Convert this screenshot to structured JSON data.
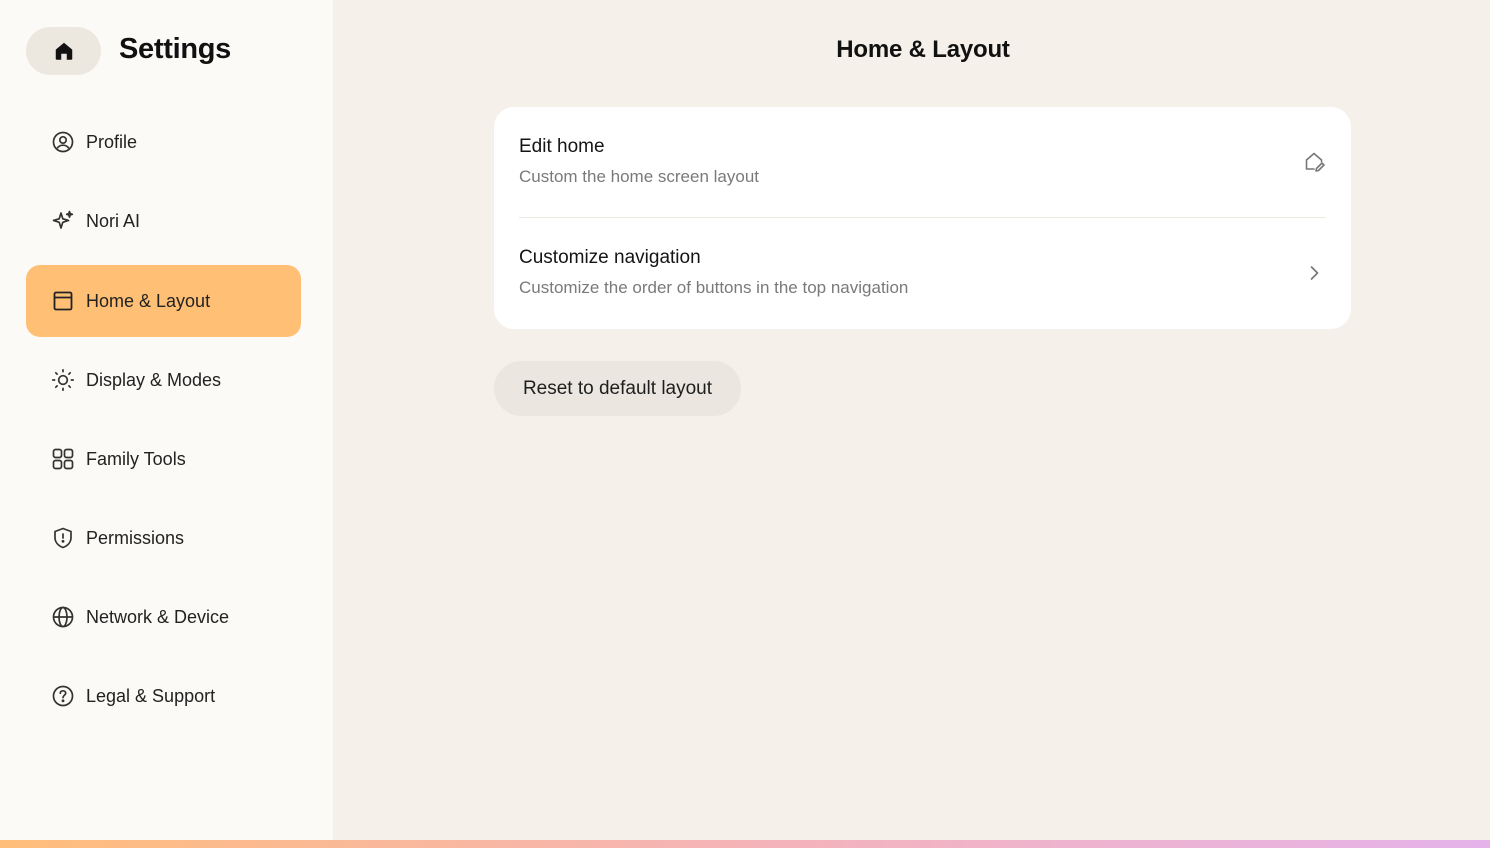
{
  "sidebar": {
    "title": "Settings",
    "home_icon": "home-icon",
    "items": [
      {
        "label": "Profile",
        "icon": "user-circle-icon"
      },
      {
        "label": "Nori AI",
        "icon": "sparkle-icon"
      },
      {
        "label": "Home & Layout",
        "icon": "layout-icon",
        "active": true
      },
      {
        "label": "Display & Modes",
        "icon": "sun-icon"
      },
      {
        "label": "Family Tools",
        "icon": "grid-icon"
      },
      {
        "label": "Permissions",
        "icon": "shield-icon"
      },
      {
        "label": "Network & Device",
        "icon": "globe-icon"
      },
      {
        "label": "Legal & Support",
        "icon": "help-circle-icon"
      }
    ]
  },
  "main": {
    "title": "Home & Layout",
    "rows": [
      {
        "title": "Edit home",
        "subtitle": "Custom the home screen layout",
        "icon": "home-edit-icon"
      },
      {
        "title": "Customize navigation",
        "subtitle": "Customize the order of buttons in the top navigation",
        "icon": "chevron-right-icon"
      }
    ],
    "reset_label": "Reset to default layout"
  },
  "colors": {
    "accent": "#ffc075",
    "background": "#f5f0e9",
    "sidebar_bg": "#fcfaf7",
    "card_bg": "#ffffff",
    "gradient": [
      "#ffbe7a",
      "#f5b3b8",
      "#e5b3ea"
    ]
  }
}
